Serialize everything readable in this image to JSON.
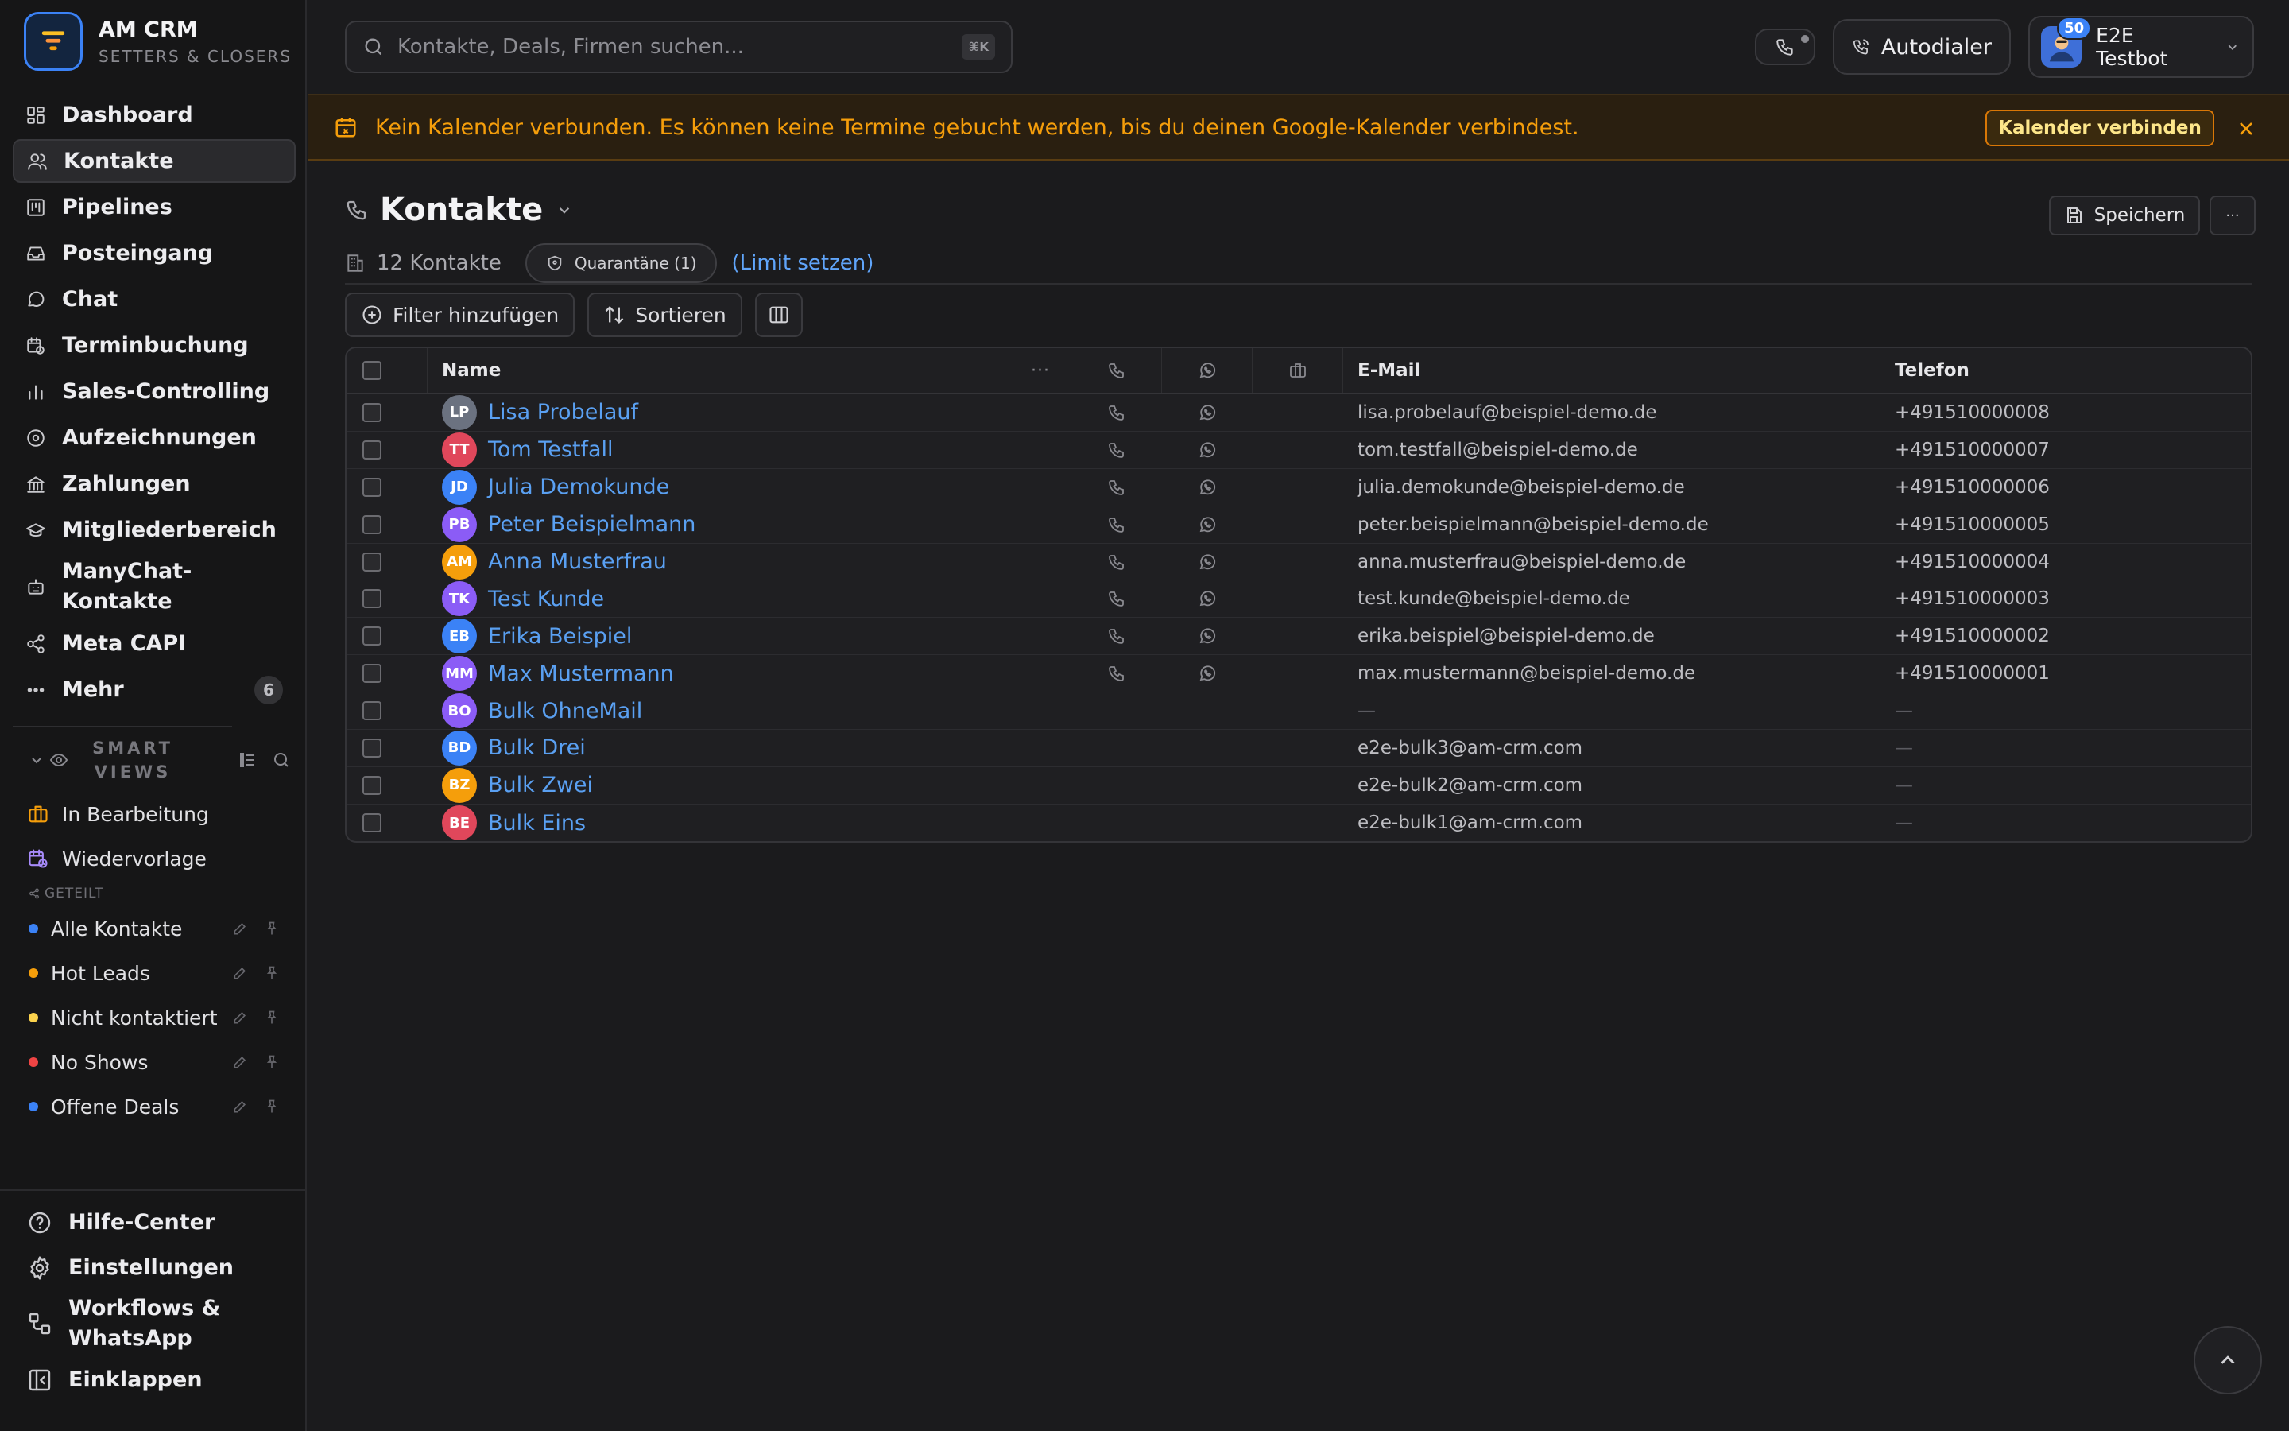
{
  "app": {
    "name": "AM CRM",
    "subtitle": "SETTERS & CLOSERS",
    "accent_color": "#3b82f6",
    "logo_icon": "funnel-icon"
  },
  "sidebar": {
    "nav": [
      {
        "label": "Dashboard",
        "icon": "dashboard-icon"
      },
      {
        "label": "Kontakte",
        "icon": "contacts-icon",
        "active": true
      },
      {
        "label": "Pipelines",
        "icon": "pipeline-icon"
      },
      {
        "label": "Posteingang",
        "icon": "inbox-icon"
      },
      {
        "label": "Chat",
        "icon": "chat-icon"
      },
      {
        "label": "Terminbuchung",
        "icon": "calendar-clock-icon"
      },
      {
        "label": "Sales-Controlling",
        "icon": "bar-chart-icon"
      },
      {
        "label": "Aufzeichnungen",
        "icon": "record-icon"
      },
      {
        "label": "Zahlungen",
        "icon": "bank-icon"
      },
      {
        "label": "Mitgliederbereich",
        "icon": "graduation-cap-icon"
      },
      {
        "label": "ManyChat-\nKontakte",
        "icon": "bot-icon"
      },
      {
        "label": "Meta CAPI",
        "icon": "share-icon"
      },
      {
        "label": "Mehr",
        "icon": "more-icon",
        "badge": "6"
      }
    ],
    "smart_views": {
      "title": "SMART\nVIEWS",
      "items": [
        {
          "label": "In Bearbeitung",
          "icon": "briefcase-icon",
          "color": "#f59e0b"
        },
        {
          "label": "Wiedervorlage",
          "icon": "calendar-clock-icon",
          "color": "#a78bfa"
        }
      ],
      "shared_label": "GETEILT",
      "shared": [
        {
          "label": "Alle Kontakte",
          "color": "#3b82f6"
        },
        {
          "label": "Hot Leads",
          "color": "#f59e0b"
        },
        {
          "label": "Nicht kontaktiert",
          "color": "#fcd34d"
        },
        {
          "label": "No Shows",
          "color": "#ef4444"
        },
        {
          "label": "Offene Deals",
          "color": "#3b82f6"
        }
      ]
    },
    "bottom": [
      {
        "label": "Hilfe-Center",
        "icon": "help-icon"
      },
      {
        "label": "Einstellungen",
        "icon": "gear-icon"
      },
      {
        "label": "Workflows &\nWhatsApp",
        "icon": "workflow-icon"
      },
      {
        "label": "Einklappen",
        "icon": "collapse-icon"
      }
    ]
  },
  "topbar": {
    "search_placeholder": "Kontakte, Deals, Firmen suchen...",
    "search_shortcut": "⌘K",
    "autodialer_label": "Autodialer",
    "user": {
      "name": "E2E Testbot",
      "badge": "50"
    }
  },
  "banner": {
    "text": "Kein Kalender verbunden. Es können keine Termine gebucht werden, bis du deinen Google-Kalender verbindest.",
    "cta": "Kalender verbinden",
    "color": "#f59e0b"
  },
  "page": {
    "title": "Kontakte",
    "save_label": "Speichern",
    "more_label": "···",
    "count_label": "12 Kontakte",
    "quarantine_label": "Quarantäne (1)",
    "limit_link": "(Limit setzen)",
    "filter_label": "Filter hinzufügen",
    "sort_label": "Sortieren"
  },
  "table": {
    "columns": {
      "name": "Name",
      "email": "E-Mail",
      "phone": "Telefon"
    },
    "rows": [
      {
        "initials": "LP",
        "color": "#6b7280",
        "name": "Lisa Probelauf",
        "email": "lisa.probelauf@beispiel-demo.de",
        "phone": "+491510000008",
        "has_actions": true
      },
      {
        "initials": "TT",
        "color": "#e0475b",
        "name": "Tom Testfall",
        "email": "tom.testfall@beispiel-demo.de",
        "phone": "+491510000007",
        "has_actions": true
      },
      {
        "initials": "JD",
        "color": "#3b82f6",
        "name": "Julia Demokunde",
        "email": "julia.demokunde@beispiel-demo.de",
        "phone": "+491510000006",
        "has_actions": true
      },
      {
        "initials": "PB",
        "color": "#8b5cf6",
        "name": "Peter Beispielmann",
        "email": "peter.beispielmann@beispiel-demo.de",
        "phone": "+491510000005",
        "has_actions": true
      },
      {
        "initials": "AM",
        "color": "#f59e0b",
        "name": "Anna Musterfrau",
        "email": "anna.musterfrau@beispiel-demo.de",
        "phone": "+491510000004",
        "has_actions": true
      },
      {
        "initials": "TK",
        "color": "#8b5cf6",
        "name": "Test Kunde",
        "email": "test.kunde@beispiel-demo.de",
        "phone": "+491510000003",
        "has_actions": true
      },
      {
        "initials": "EB",
        "color": "#3b82f6",
        "name": "Erika Beispiel",
        "email": "erika.beispiel@beispiel-demo.de",
        "phone": "+491510000002",
        "has_actions": true
      },
      {
        "initials": "MM",
        "color": "#8b5cf6",
        "name": "Max Mustermann",
        "email": "max.mustermann@beispiel-demo.de",
        "phone": "+491510000001",
        "has_actions": true
      },
      {
        "initials": "BO",
        "color": "#8b5cf6",
        "name": "Bulk OhneMail",
        "email": "—",
        "phone": "—",
        "has_actions": false
      },
      {
        "initials": "BD",
        "color": "#3b82f6",
        "name": "Bulk Drei",
        "email": "e2e-bulk3@am-crm.com",
        "phone": "—",
        "has_actions": false
      },
      {
        "initials": "BZ",
        "color": "#f59e0b",
        "name": "Bulk Zwei",
        "email": "e2e-bulk2@am-crm.com",
        "phone": "—",
        "has_actions": false
      },
      {
        "initials": "BE",
        "color": "#e0475b",
        "name": "Bulk Eins",
        "email": "e2e-bulk1@am-crm.com",
        "phone": "—",
        "has_actions": false
      }
    ]
  }
}
